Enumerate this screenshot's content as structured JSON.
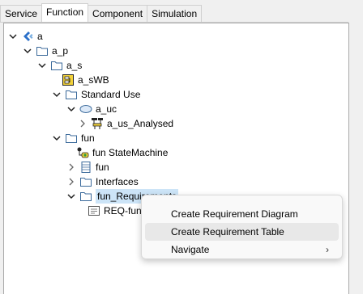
{
  "tabs": [
    "Service",
    "Function",
    "Component",
    "Simulation"
  ],
  "active_tab": "Function",
  "tree": {
    "root": "a",
    "a_p": "a_p",
    "a_s": "a_s",
    "a_swb": "a_sWB",
    "standard_use": "Standard Use",
    "a_uc": "a_uc",
    "a_us_analysed": "a_us_Analysed",
    "fun_folder": "fun",
    "fun_statemachine": "fun StateMachine",
    "fun_item": "fun",
    "interfaces": "Interfaces",
    "fun_requirements": "fun_Requirements",
    "req_fun": "REQ-fun"
  },
  "context_menu": {
    "items": [
      {
        "label": "Create Requirement Diagram"
      },
      {
        "label": "Create Requirement Table"
      },
      {
        "label": "Navigate",
        "submenu_arrow": "›"
      }
    ],
    "hovered_index": 1
  },
  "colors": {
    "folder_stroke": "#3b6a9b",
    "package_blue": "#2b70c9",
    "selection": "#cce4f7"
  }
}
